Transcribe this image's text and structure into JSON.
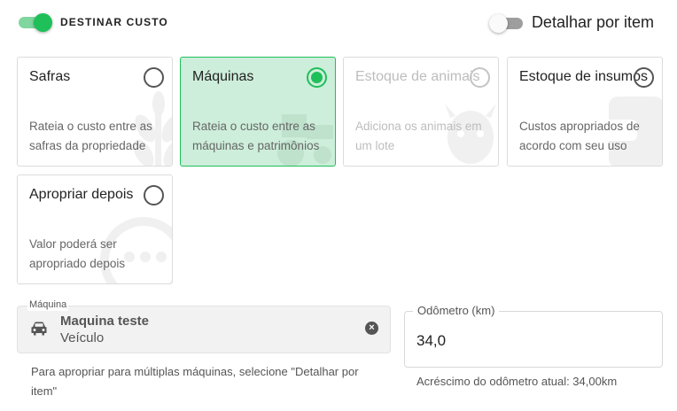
{
  "header": {
    "destinar_label": "DESTINAR CUSTO",
    "destinar_on": true,
    "detalhar_label": "Detalhar por item",
    "detalhar_on": false
  },
  "options": [
    {
      "title": "Safras",
      "description": "Rateia o custo entre as safras da propriedade",
      "state": "unselected",
      "icon": "wheat-icon"
    },
    {
      "title": "Máquinas",
      "description": "Rateia o custo entre as máquinas e patrimônios",
      "state": "selected",
      "icon": "tractor-icon"
    },
    {
      "title": "Estoque de animais",
      "description": "Adiciona os animais em um lote",
      "state": "disabled",
      "icon": "cow-icon"
    },
    {
      "title": "Estoque de insumos",
      "description": "Custos apropriados de acordo com seu uso",
      "state": "unselected",
      "icon": "bag-icon"
    },
    {
      "title": "Apropriar depois",
      "description": "Valor poderá ser apropriado depois",
      "state": "unselected",
      "icon": "ellipsis-icon"
    }
  ],
  "machine_field": {
    "label": "Máquina",
    "value_primary": "Maquina teste",
    "value_secondary": "Veículo",
    "icon": "car-icon",
    "helper": "Para apropriar para múltiplas máquinas, selecione \"Detalhar por item\""
  },
  "odometer_field": {
    "label": "Odômetro (km)",
    "value": "34,0",
    "helper": "Acréscimo do odômetro atual: 34,00km"
  },
  "colors": {
    "accent": "#1fbf5a",
    "selected_bg": "#cdeeda"
  }
}
